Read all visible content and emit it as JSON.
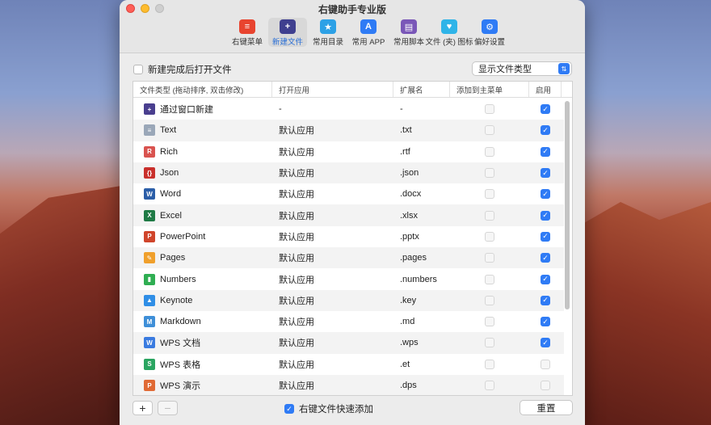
{
  "window": {
    "title": "右键助手专业版"
  },
  "toolbar": [
    {
      "label": "右键菜单",
      "icon": "list-icon",
      "glyph": "≡",
      "color": "#e8442f",
      "active": false
    },
    {
      "label": "新建文件",
      "icon": "new-file-icon",
      "glyph": "+",
      "color": "#3f3f8f",
      "active": true
    },
    {
      "label": "常用目录",
      "icon": "folder-star-icon",
      "glyph": "★",
      "color": "#2da1e6",
      "active": false
    },
    {
      "label": "常用 APP",
      "icon": "app-store-icon",
      "glyph": "A",
      "color": "#2f7bf5",
      "active": false
    },
    {
      "label": "常用脚本",
      "icon": "script-icon",
      "glyph": "▤",
      "color": "#7a57b8",
      "active": false
    },
    {
      "label": "文件 (夹) 图标",
      "icon": "folder-heart-icon",
      "glyph": "♥",
      "color": "#2fb4e8",
      "active": false
    },
    {
      "label": "偏好设置",
      "icon": "gear-icon",
      "glyph": "⚙",
      "color": "#2f7bf5",
      "active": false
    }
  ],
  "options": {
    "open_after_create": "新建完成后打开文件",
    "display_select": "显示文件类型",
    "quick_add": "右键文件快速添加",
    "reset": "重置",
    "add_btn": "+",
    "remove_btn": "−"
  },
  "table": {
    "headers": [
      "文件类型 (拖动排序, 双击修改)",
      "打开应用",
      "扩展名",
      "添加到主菜单",
      "启用"
    ],
    "rows": [
      {
        "name": "通过窗口新建",
        "app": "-",
        "ext": "-",
        "icon": "window-new-icon",
        "color": "#4a3f8f",
        "glyph": "+",
        "main": false,
        "enabled": true
      },
      {
        "name": "Text",
        "app": "默认应用",
        "ext": ".txt",
        "icon": "text-file-icon",
        "color": "#9aa7b8",
        "glyph": "≡",
        "main": false,
        "enabled": true
      },
      {
        "name": "Rich",
        "app": "默认应用",
        "ext": ".rtf",
        "icon": "rtf-file-icon",
        "color": "#d9534f",
        "glyph": "R",
        "main": false,
        "enabled": true
      },
      {
        "name": "Json",
        "app": "默认应用",
        "ext": ".json",
        "icon": "json-file-icon",
        "color": "#c9302c",
        "glyph": "{}",
        "main": false,
        "enabled": true
      },
      {
        "name": "Word",
        "app": "默认应用",
        "ext": ".docx",
        "icon": "word-icon",
        "color": "#2b5ea8",
        "glyph": "W",
        "main": false,
        "enabled": true
      },
      {
        "name": "Excel",
        "app": "默认应用",
        "ext": ".xlsx",
        "icon": "excel-icon",
        "color": "#1f7a45",
        "glyph": "X",
        "main": false,
        "enabled": true
      },
      {
        "name": "PowerPoint",
        "app": "默认应用",
        "ext": ".pptx",
        "icon": "powerpoint-icon",
        "color": "#d0452b",
        "glyph": "P",
        "main": false,
        "enabled": true
      },
      {
        "name": "Pages",
        "app": "默认应用",
        "ext": ".pages",
        "icon": "pages-icon",
        "color": "#f0a02c",
        "glyph": "✎",
        "main": false,
        "enabled": true
      },
      {
        "name": "Numbers",
        "app": "默认应用",
        "ext": ".numbers",
        "icon": "numbers-icon",
        "color": "#2fae52",
        "glyph": "▮",
        "main": false,
        "enabled": true
      },
      {
        "name": "Keynote",
        "app": "默认应用",
        "ext": ".key",
        "icon": "keynote-icon",
        "color": "#2f8ee6",
        "glyph": "▲",
        "main": false,
        "enabled": true
      },
      {
        "name": "Markdown",
        "app": "默认应用",
        "ext": ".md",
        "icon": "markdown-icon",
        "color": "#3f8fd8",
        "glyph": "M",
        "main": false,
        "enabled": true
      },
      {
        "name": "WPS 文档",
        "app": "默认应用",
        "ext": ".wps",
        "icon": "wps-doc-icon",
        "color": "#3a7be0",
        "glyph": "W",
        "main": false,
        "enabled": true
      },
      {
        "name": "WPS 表格",
        "app": "默认应用",
        "ext": ".et",
        "icon": "wps-sheet-icon",
        "color": "#2aa561",
        "glyph": "S",
        "main": false,
        "enabled": false
      },
      {
        "name": "WPS 演示",
        "app": "默认应用",
        "ext": ".dps",
        "icon": "wps-slides-icon",
        "color": "#e06a35",
        "glyph": "P",
        "main": false,
        "enabled": false
      }
    ]
  }
}
